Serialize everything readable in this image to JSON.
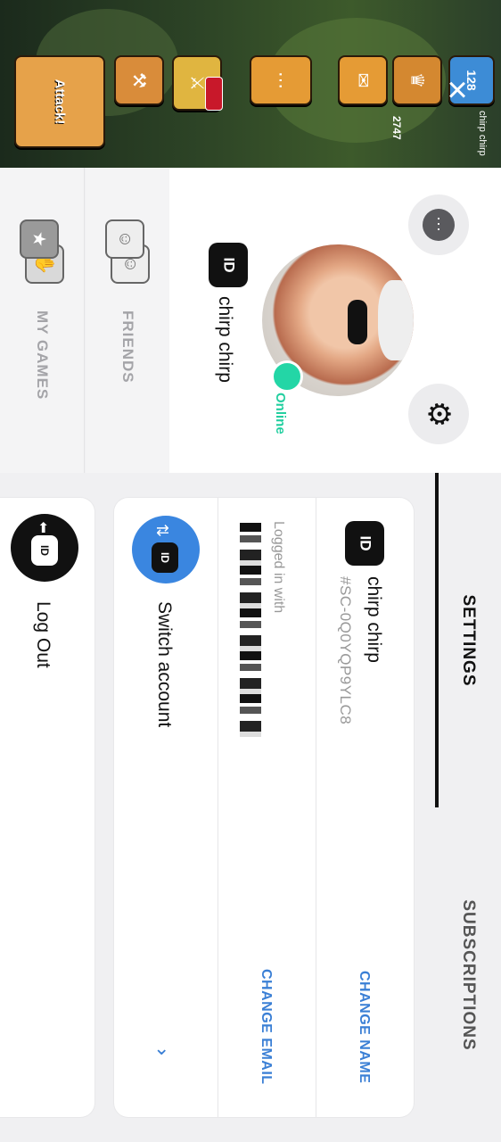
{
  "game": {
    "attack_label": "Attack!",
    "trophies": "2747",
    "player": "chirp chirp",
    "level": "128"
  },
  "close_icon": "×",
  "profile": {
    "name": "chirp chirp",
    "id_badge": "ID",
    "status": "Online"
  },
  "side_nav": {
    "my_games": "MY GAMES",
    "friends": "FRIENDS"
  },
  "tabs": {
    "settings": "SETTINGS",
    "subscriptions": "SUBSCRIPTIONS"
  },
  "account": {
    "name": "chirp chirp",
    "tag": "#SC-0Q0YQP9YLC8",
    "change_name": "CHANGE NAME",
    "logged_in_with": "Logged in with",
    "change_email": "CHANGE EMAIL",
    "switch_account": "Switch account"
  },
  "logout": {
    "label": "Log Out"
  },
  "colors": {
    "accent_blue": "#3a7fd5",
    "online_green": "#23d6a6"
  }
}
